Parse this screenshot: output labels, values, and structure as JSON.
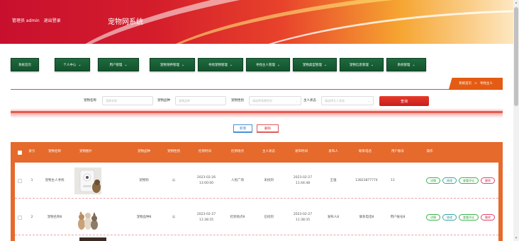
{
  "header": {
    "user_label": "管理员 admin",
    "logout_label": "退出登录",
    "site_title": "宠物网系统"
  },
  "nav": [
    {
      "label": "系统首页",
      "has_menu": false
    },
    {
      "label": "个人中心",
      "has_menu": true
    },
    {
      "label": "用户管理",
      "has_menu": true
    },
    {
      "label": "宠物领养管理",
      "has_menu": true
    },
    {
      "label": "寻找宠物管理",
      "has_menu": true
    },
    {
      "label": "寻找主人管理",
      "has_menu": true
    },
    {
      "label": "宠物类型管理",
      "has_menu": true
    },
    {
      "label": "宠物信息管理",
      "has_menu": true
    },
    {
      "label": "系统管理",
      "has_menu": true
    }
  ],
  "breadcrumb": {
    "home": "系统首页",
    "sep": ">",
    "current": "寻找主人"
  },
  "search": {
    "name_label": "宠物名称",
    "name_placeholder": "宠物名称",
    "breed_label": "宠物品种",
    "breed_placeholder": "宠物品种",
    "gender_label": "宠物性别",
    "gender_placeholder": "请选择宠物性别",
    "status_label": "主人状态",
    "status_placeholder": "请选择主人状态",
    "query_label": "查询"
  },
  "actions": {
    "add_label": "新增",
    "delete_label": "删除"
  },
  "table": {
    "headers": [
      "索引",
      "宠物名称",
      "宠物图片",
      "宠物品种",
      "宠物性别",
      "捡到时间",
      "捡到地点",
      "主人状态",
      "发布时间",
      "发布人",
      "联系电话",
      "用户账号",
      "操作"
    ],
    "rows": [
      {
        "index": "1",
        "name": "宠物主人寻找",
        "breed": "宠物狗",
        "gender": "公",
        "found_time": "2023-02-26 13:00:00",
        "found_place": "人民广场",
        "status": "未找到",
        "publish_time": "2023-02-27 11:44:48",
        "publisher": "王强",
        "phone": "13823877774",
        "account": "11",
        "image": "product-photo"
      },
      {
        "index": "2",
        "name": "宠物名称8",
        "breed": "宠物品种8",
        "gender": "公",
        "found_time": "2023-02-27 11:38:35",
        "found_place": "捡到地点8",
        "status": "已找到",
        "publish_time": "2023-02-27 11:38:35",
        "publisher": "发布人8",
        "phone": "联系电话8",
        "account": "用户账号8",
        "image": "dogs-photo"
      }
    ],
    "row_ops": [
      "详情",
      "修改",
      "查看评论",
      "删除"
    ]
  },
  "colors": {
    "header_red": "#c8102e",
    "nav_green": "#1d6b3e",
    "table_orange": "#e56a2c",
    "accent_red": "#e5482b"
  }
}
